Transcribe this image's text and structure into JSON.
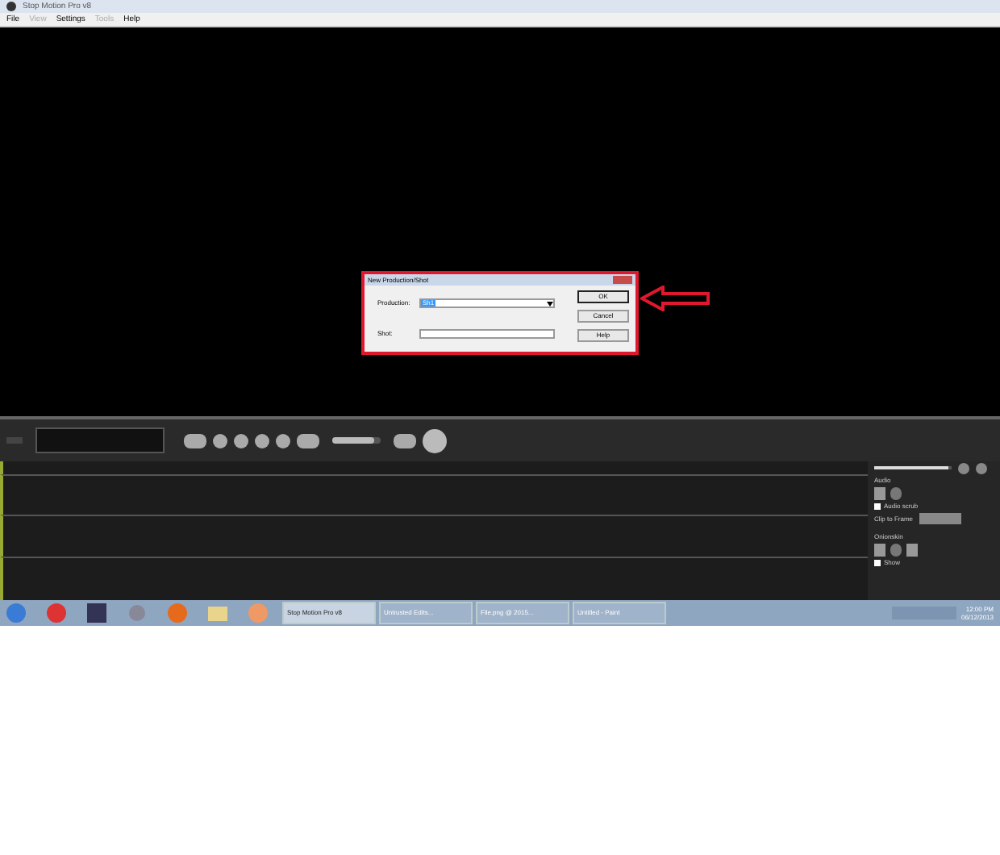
{
  "window": {
    "title": "Stop Motion Pro v8"
  },
  "menu": [
    {
      "label": "File",
      "disabled": false
    },
    {
      "label": "View",
      "disabled": true
    },
    {
      "label": "Settings",
      "disabled": false
    },
    {
      "label": "Tools",
      "disabled": true
    },
    {
      "label": "Help",
      "disabled": false
    }
  ],
  "dialog": {
    "title": "New Production/Shot",
    "fields": [
      {
        "label": "Production:",
        "kind": "dropdown",
        "value": "Sh1"
      },
      {
        "label": "Shot:",
        "kind": "text"
      }
    ],
    "buttons": [
      {
        "label": "OK",
        "selected": true
      },
      {
        "label": "Cancel",
        "selected": false
      },
      {
        "label": "Help",
        "selected": false
      }
    ]
  },
  "toolbar": {
    "slider": {
      "level": 0.85
    }
  },
  "side_panel": {
    "slider": {
      "level": 0.95
    },
    "audio_label": "Audio",
    "audio_scrub": {
      "label": "Audio scrub",
      "checked": false
    },
    "clip_to_frame": {
      "label": "Clip to Frame"
    },
    "onion_label": "Onionskin",
    "show": {
      "label": "Show",
      "checked": false
    }
  },
  "taskbar": {
    "items": [
      {
        "label": "Stop Motion Pro v8",
        "selected": true
      },
      {
        "label": "Untrusted Edits...",
        "selected": false
      },
      {
        "label": "File.png @ 2015...",
        "selected": false
      },
      {
        "label": "Untitled - Paint",
        "selected": false
      }
    ],
    "time": "12:00 PM",
    "date": "06/12/2013"
  }
}
